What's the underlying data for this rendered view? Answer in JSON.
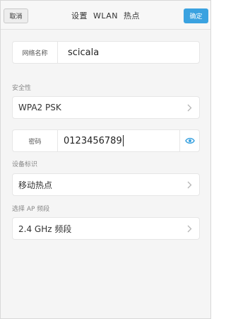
{
  "header": {
    "cancel_label": "取消",
    "title": "设置  WLAN  热点",
    "confirm_label": "确定"
  },
  "network_name": {
    "label": "网络名称",
    "value": "scicala"
  },
  "security": {
    "section_label": "安全性",
    "selected": "WPA2 PSK"
  },
  "password": {
    "label": "密码",
    "value": "0123456789"
  },
  "device_id": {
    "section_label": "设备标识",
    "selected": "移动热点"
  },
  "ap_band": {
    "section_label": "选择 AP 频段",
    "selected": "2.4 GHz 频段"
  },
  "icons": {
    "chevron": "chevron-right-icon",
    "eye": "eye-icon"
  },
  "colors": {
    "accent": "#3aa2e0",
    "background": "#f5f5f5"
  }
}
